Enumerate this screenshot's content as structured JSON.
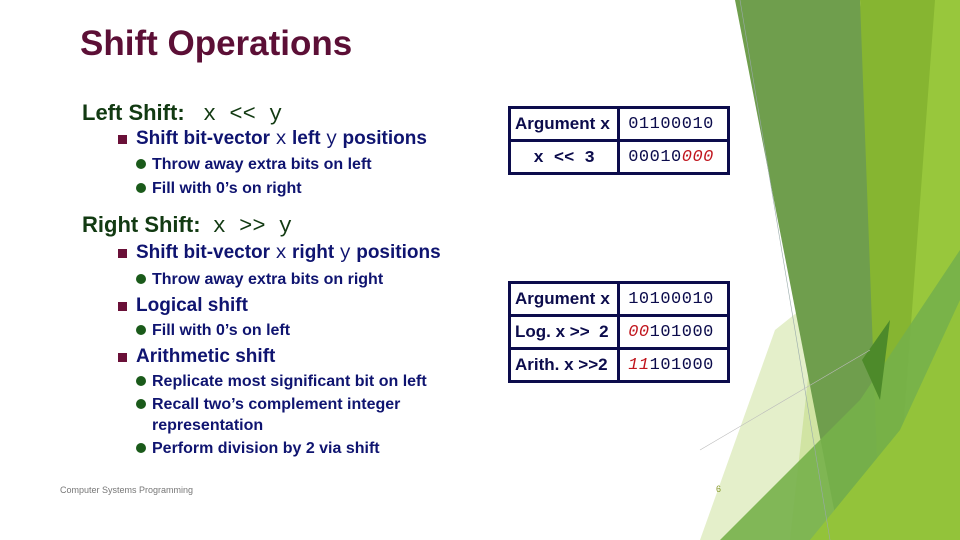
{
  "slide": {
    "title": "Shift Operations",
    "left_shift": {
      "heading_label": "Left Shift:",
      "heading_expr": "x << y",
      "bullet": {
        "pre": "Shift bit-vector ",
        "x": "x",
        "mid": " left ",
        "y": "y",
        "post": " positions"
      },
      "subbullets": [
        "Throw away extra bits on left",
        "Fill with 0’s on right"
      ]
    },
    "right_shift": {
      "heading_label": "Right Shift:",
      "heading_expr": "x >> y",
      "bullet": {
        "pre": "Shift bit-vector ",
        "x": "x",
        "mid": " right ",
        "y": "y",
        "post": " positions"
      },
      "bullet_sub": "Throw away extra bits on right",
      "logical": {
        "label": "Logical shift",
        "subbullets": [
          "Fill with 0’s on left"
        ]
      },
      "arithmetic": {
        "label": "Arithmetic shift",
        "subbullets": [
          "Replicate most significant bit on left",
          "Recall two’s complement integer",
          "representation",
          "Perform division by 2 via shift"
        ]
      }
    },
    "table_left": {
      "rows": [
        {
          "label_text": "Argument ",
          "label_mono": "x",
          "value_plain": "01100010",
          "value_red": ""
        },
        {
          "label_text": "",
          "label_mono": "x << 3",
          "value_plain": "00010",
          "value_red": "000"
        }
      ]
    },
    "table_right": {
      "rows": [
        {
          "label_text": "Argument ",
          "label_mono": "x",
          "value_prefix_red": "",
          "value_plain": "10100010"
        },
        {
          "label_text": "Log. x >>  2",
          "label_mono": "",
          "value_prefix_red": "00",
          "value_plain": "101000"
        },
        {
          "label_text": "Arith. x >>2",
          "label_mono": "",
          "value_prefix_red": "11",
          "value_plain": "101000"
        }
      ]
    },
    "footer": "Computer Systems Programming",
    "page_number": "6"
  },
  "colors": {
    "title": "#5c0f36",
    "heading": "#123a12",
    "body_text": "#0f1470",
    "highlight_red": "#c0151d",
    "table_border": "#0c0c4c"
  }
}
